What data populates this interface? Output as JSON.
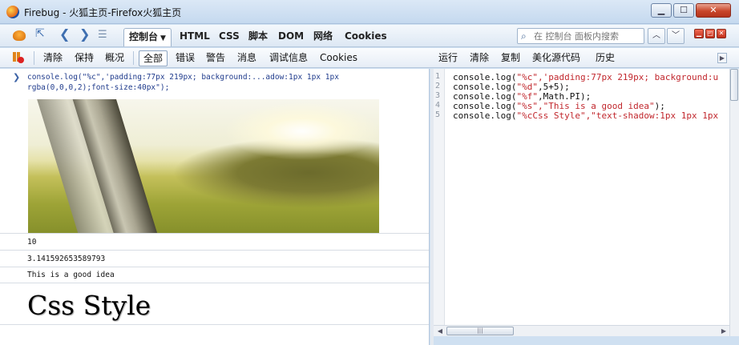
{
  "window": {
    "title": "Firebug - 火狐主页-Firefox火狐主页",
    "minimize_label": "▁",
    "maximize_label": "☐",
    "close_label": "✕"
  },
  "firebug_toolbar": {
    "tabs": [
      {
        "label": "控制台",
        "active": true
      },
      {
        "label": "HTML"
      },
      {
        "label": "CSS"
      },
      {
        "label": "脚本"
      },
      {
        "label": "DOM"
      },
      {
        "label": "网络"
      },
      {
        "label": "Cookies"
      }
    ],
    "search": {
      "placeholder": "在 控制台 面板内搜索",
      "icon": "search-icon"
    },
    "search_prev_label": "︿",
    "search_next_label": "﹀"
  },
  "console_toolbar": {
    "left_buttons": [
      "清除",
      "保持",
      "概况"
    ],
    "filters": [
      {
        "label": "全部",
        "active": true
      },
      {
        "label": "错误"
      },
      {
        "label": "警告"
      },
      {
        "label": "消息"
      },
      {
        "label": "调试信息"
      },
      {
        "label": "Cookies"
      }
    ],
    "editor_buttons": [
      "运行",
      "清除",
      "复制",
      "美化源代码",
      "历史"
    ]
  },
  "console_log": {
    "command": "console.log(\"%c\",'padding:77px 219px; background:...adow:1px 1px 1px rgba(0,0,0,2);font-size:40px\");",
    "outputs": [
      "10",
      "3.141592653589793",
      "This is a good idea"
    ],
    "styled_output": "Css Style"
  },
  "editor": {
    "line_numbers": [
      "1",
      "2",
      "3",
      "4",
      "5"
    ],
    "lines": [
      {
        "pre": "console.log(",
        "str": "\"%c\",'padding:77px 219px; background:u",
        "post": ""
      },
      {
        "pre": "console.log(",
        "str": "\"%d\"",
        "post": ",5+5);"
      },
      {
        "pre": "console.log(",
        "str": "\"%f\"",
        "post": ",Math.PI);"
      },
      {
        "pre": "console.log(",
        "str": "\"%s\",\"This is a good idea\"",
        "post": ");"
      },
      {
        "pre": "console.log(",
        "str": "\"%cCss Style\",\"text-shadow:1px 1px 1px",
        "post": ""
      }
    ],
    "scroll_left_label": "◀",
    "scroll_right_label": "▶",
    "scroll_thumb_label": "|||"
  }
}
